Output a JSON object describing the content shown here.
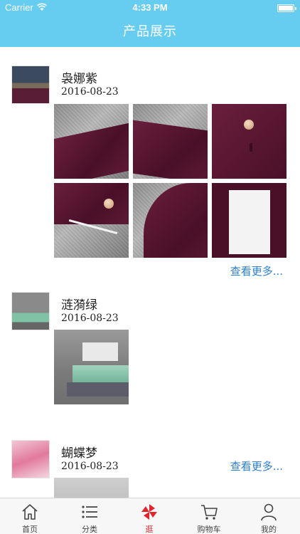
{
  "status_bar": {
    "carrier": "Carrier",
    "time": "4:33 PM"
  },
  "nav": {
    "title": "产品展示"
  },
  "posts": [
    {
      "name": "袅娜紫",
      "date": "2016-08-23",
      "more": "查看更多..."
    },
    {
      "name": "涟漪绿",
      "date": "2016-08-23",
      "more": "查看更多..."
    },
    {
      "name": "蝴蝶梦",
      "date": "2016-08-23"
    }
  ],
  "tabs": [
    {
      "label": "首页",
      "icon": "home-icon"
    },
    {
      "label": "分类",
      "icon": "list-icon"
    },
    {
      "label": "逛",
      "icon": "pinwheel-icon",
      "active": true
    },
    {
      "label": "购物车",
      "icon": "cart-icon"
    },
    {
      "label": "我的",
      "icon": "user-icon"
    }
  ],
  "colors": {
    "nav": "#66cdf0",
    "link": "#2e7fd1",
    "active_tab": "#e3242b"
  }
}
